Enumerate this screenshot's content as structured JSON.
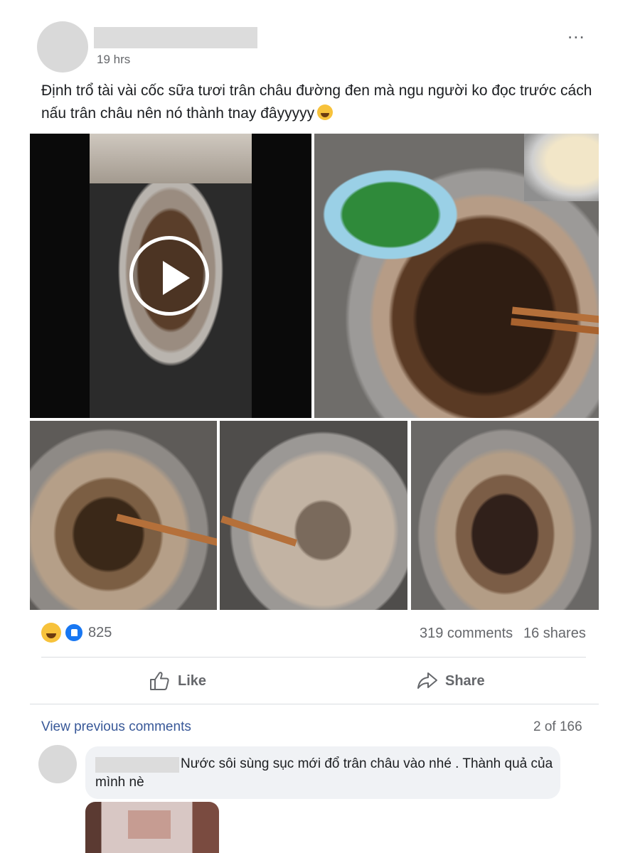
{
  "post": {
    "timestamp": "19 hrs",
    "more_icon": "...",
    "text": "Định trổ tài vài cốc sữa tươi trân châu đường đen mà ngu người ko đọc trước cách nấu trân châu nên nó thành tnay đâyyyyy",
    "text_emoji": "rolling-on-floor-laughing"
  },
  "stats": {
    "reaction_icons": [
      "haha",
      "like"
    ],
    "reaction_count": "825",
    "comments": "319 comments",
    "shares": "16 shares"
  },
  "actions": {
    "like_label": "Like",
    "share_label": "Share"
  },
  "comments_section": {
    "view_previous": "View previous comments",
    "page_count": "2 of 166",
    "comment": {
      "text": "Nước sôi sùng sục mới đổ trân châu vào nhé . Thành quả của mình nè"
    }
  },
  "colors": {
    "link": "#385898",
    "muted": "#65676b",
    "like_blue": "#1877f2",
    "bubble_bg": "#f0f2f5"
  }
}
